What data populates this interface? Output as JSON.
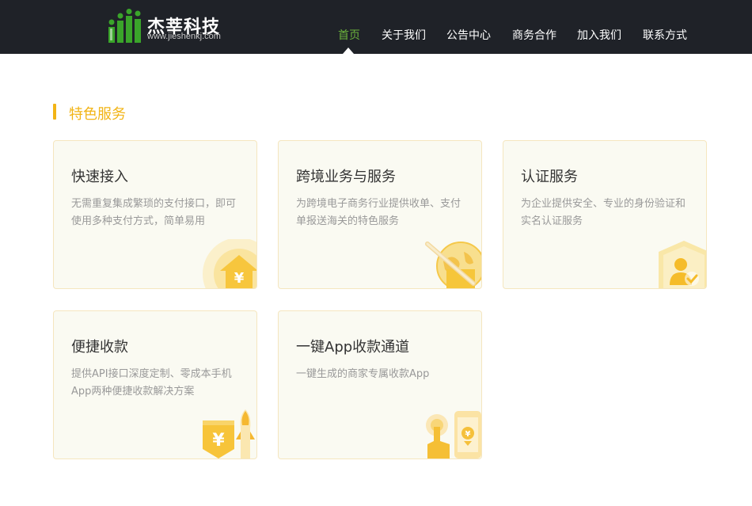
{
  "header": {
    "logo": {
      "title": "杰莘科技",
      "url": "www.jieshenkj.com"
    },
    "nav": [
      {
        "label": "首页",
        "active": true
      },
      {
        "label": "关于我们",
        "active": false
      },
      {
        "label": "公告中心",
        "active": false
      },
      {
        "label": "商务合作",
        "active": false
      },
      {
        "label": "加入我们",
        "active": false
      },
      {
        "label": "联系方式",
        "active": false
      }
    ]
  },
  "section": {
    "title": "特色服务"
  },
  "services": [
    {
      "title": "快速接入",
      "desc": "无需重复集成繁琐的支付接口，即可使用多种支付方式，简单易用",
      "icon": "yuan-house-icon"
    },
    {
      "title": "跨境业务与服务",
      "desc": "为跨境电子商务行业提供收单、支付单报送海关的特色服务",
      "icon": "globe-plane-icon"
    },
    {
      "title": "认证服务",
      "desc": "为企业提供安全、专业的身份验证和实名认证服务",
      "icon": "shield-user-icon"
    },
    {
      "title": "便捷收款",
      "desc": "提供API接口深度定制、零成本手机App两种便捷收款解决方案",
      "icon": "yuan-rocket-icon"
    },
    {
      "title": "一键App收款通道",
      "desc": "一键生成的商家专属收款App",
      "icon": "phone-tap-icon"
    }
  ],
  "colors": {
    "accent": "#f2b416",
    "nav_active": "#6bb23c",
    "header_bg": "#1f2228",
    "card_bg": "#fafaf2",
    "card_border": "#f5e6bf",
    "logo_green": "#3aa52a"
  }
}
